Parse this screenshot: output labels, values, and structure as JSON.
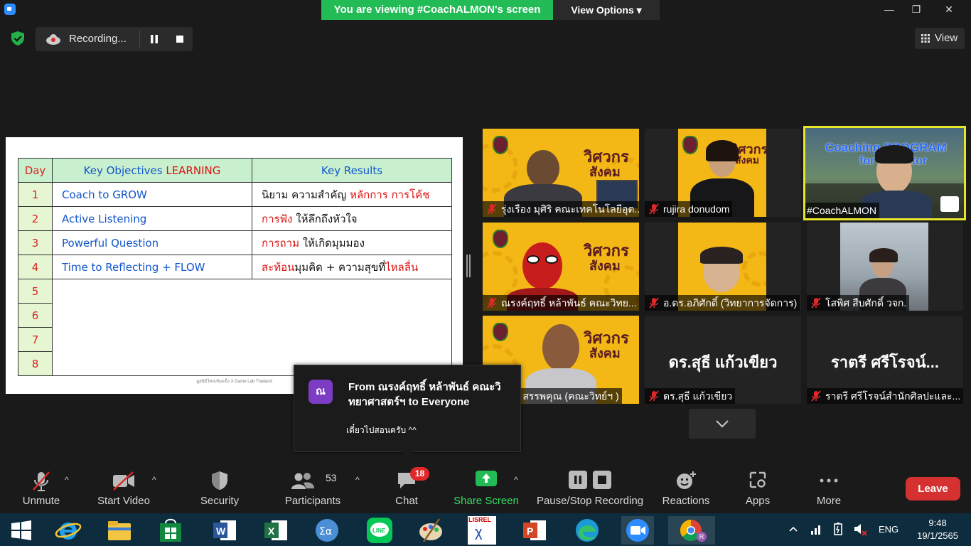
{
  "top_bar": {
    "banner_text": "You are viewing #CoachALMON's screen",
    "view_options_label": "View Options",
    "view_options_chevron": "▾",
    "minimize_glyph": "—",
    "maximize_glyph": "❐",
    "close_glyph": "✕"
  },
  "recording": {
    "status_text": "Recording..."
  },
  "view_button_label": "View",
  "slide": {
    "headers": {
      "day": "Day",
      "objectives_prefix": "Key Objectives ",
      "objectives_emphasis": "LEARNING",
      "results": "Key Results"
    },
    "rows": [
      {
        "day": "1",
        "objective": "Coach to GROW",
        "result_plain": "นิยาม ความสำคัญ ",
        "result_red": "หลักการ การโค้ช",
        "result_after": ""
      },
      {
        "day": "2",
        "objective": "Active Listening",
        "result_plain": "",
        "result_red": "การฟัง",
        "result_after": " ให้ลึกถึงหัวใจ"
      },
      {
        "day": "3",
        "objective": "Powerful Question",
        "result_plain": "",
        "result_red": "การถาม",
        "result_after": " ให้เกิดมุมมอง"
      },
      {
        "day": "4",
        "objective": "Time to Reflecting + FLOW",
        "result_plain": "",
        "result_red": "สะท้อน",
        "result_after": "มุมคิด + ความสุขที่",
        "result_red2": "ไหลลื่น"
      },
      {
        "day": "5"
      },
      {
        "day": "6"
      },
      {
        "day": "7"
      },
      {
        "day": "8"
      }
    ],
    "footer": "มูลนิธิไทยเข้มแข็ง X Game Lab Thailand"
  },
  "participants": [
    {
      "name": "รุ่งเรือง มุศิริ คณะเทคโนโลยีอุต...",
      "type": "poster-person"
    },
    {
      "name": "rujira donudom",
      "type": "poster-woman"
    },
    {
      "name": "#CoachALMON",
      "type": "coach",
      "title_line1": "Coaching PROGRAM",
      "title_line2": "for Educator"
    },
    {
      "name": "ณรงค์ฤทธิ์ หล้าพันธ์ คณะวิทย...",
      "type": "poster-spider"
    },
    {
      "name": "อ.ดร.อภิศักดิ์ (วิทยาการจัดการ)",
      "type": "poster-man"
    },
    {
      "name": "โสพิศ สืบศักดิ์ วจก.",
      "type": "sky"
    },
    {
      "name": "ชาติ สรรพคุณ (คณะวิทย์ฯ )",
      "type": "poster-older"
    },
    {
      "name": "ดร.สุธี  แก้วเขียว",
      "type": "text",
      "big_name": "ดร.สุธี  แก้วเขียว"
    },
    {
      "name": "ราตรี   ศรีโรจน์สำนักศิลปะและ...",
      "type": "text",
      "big_name": "ราตรี   ศรีโรจน์..."
    }
  ],
  "poster_text": {
    "line1": "วิศวกร",
    "line2": "สังคม"
  },
  "chat_popup": {
    "avatar_letter": "ณ",
    "from_text": "From ณรงค์ฤทธิ์ หล้าพันธ์ คณะวิทยาศาสตร์ฯ to Everyone",
    "message": "เดี๋ยวไปสอนครับ ^^"
  },
  "toolbar": {
    "unmute": "Unmute",
    "start_video": "Start Video",
    "security": "Security",
    "participants": "Participants",
    "participants_count": "53",
    "chat": "Chat",
    "chat_badge": "18",
    "share_screen": "Share Screen",
    "pause_stop_recording": "Pause/Stop Recording",
    "reactions": "Reactions",
    "apps": "Apps",
    "more": "More",
    "leave": "Leave",
    "caret": "^"
  },
  "taskbar": {
    "language": "ENG",
    "time": "9:48",
    "date": "19/1/2565",
    "lisrel_label": "LISREL",
    "chrome_badge": "R"
  },
  "colors": {
    "accent_green": "#22bb55",
    "leave_red": "#d63131",
    "active_speaker": "#e8e62b",
    "chat_avatar": "#7d3cc4",
    "poster_yellow": "#f3b816"
  }
}
